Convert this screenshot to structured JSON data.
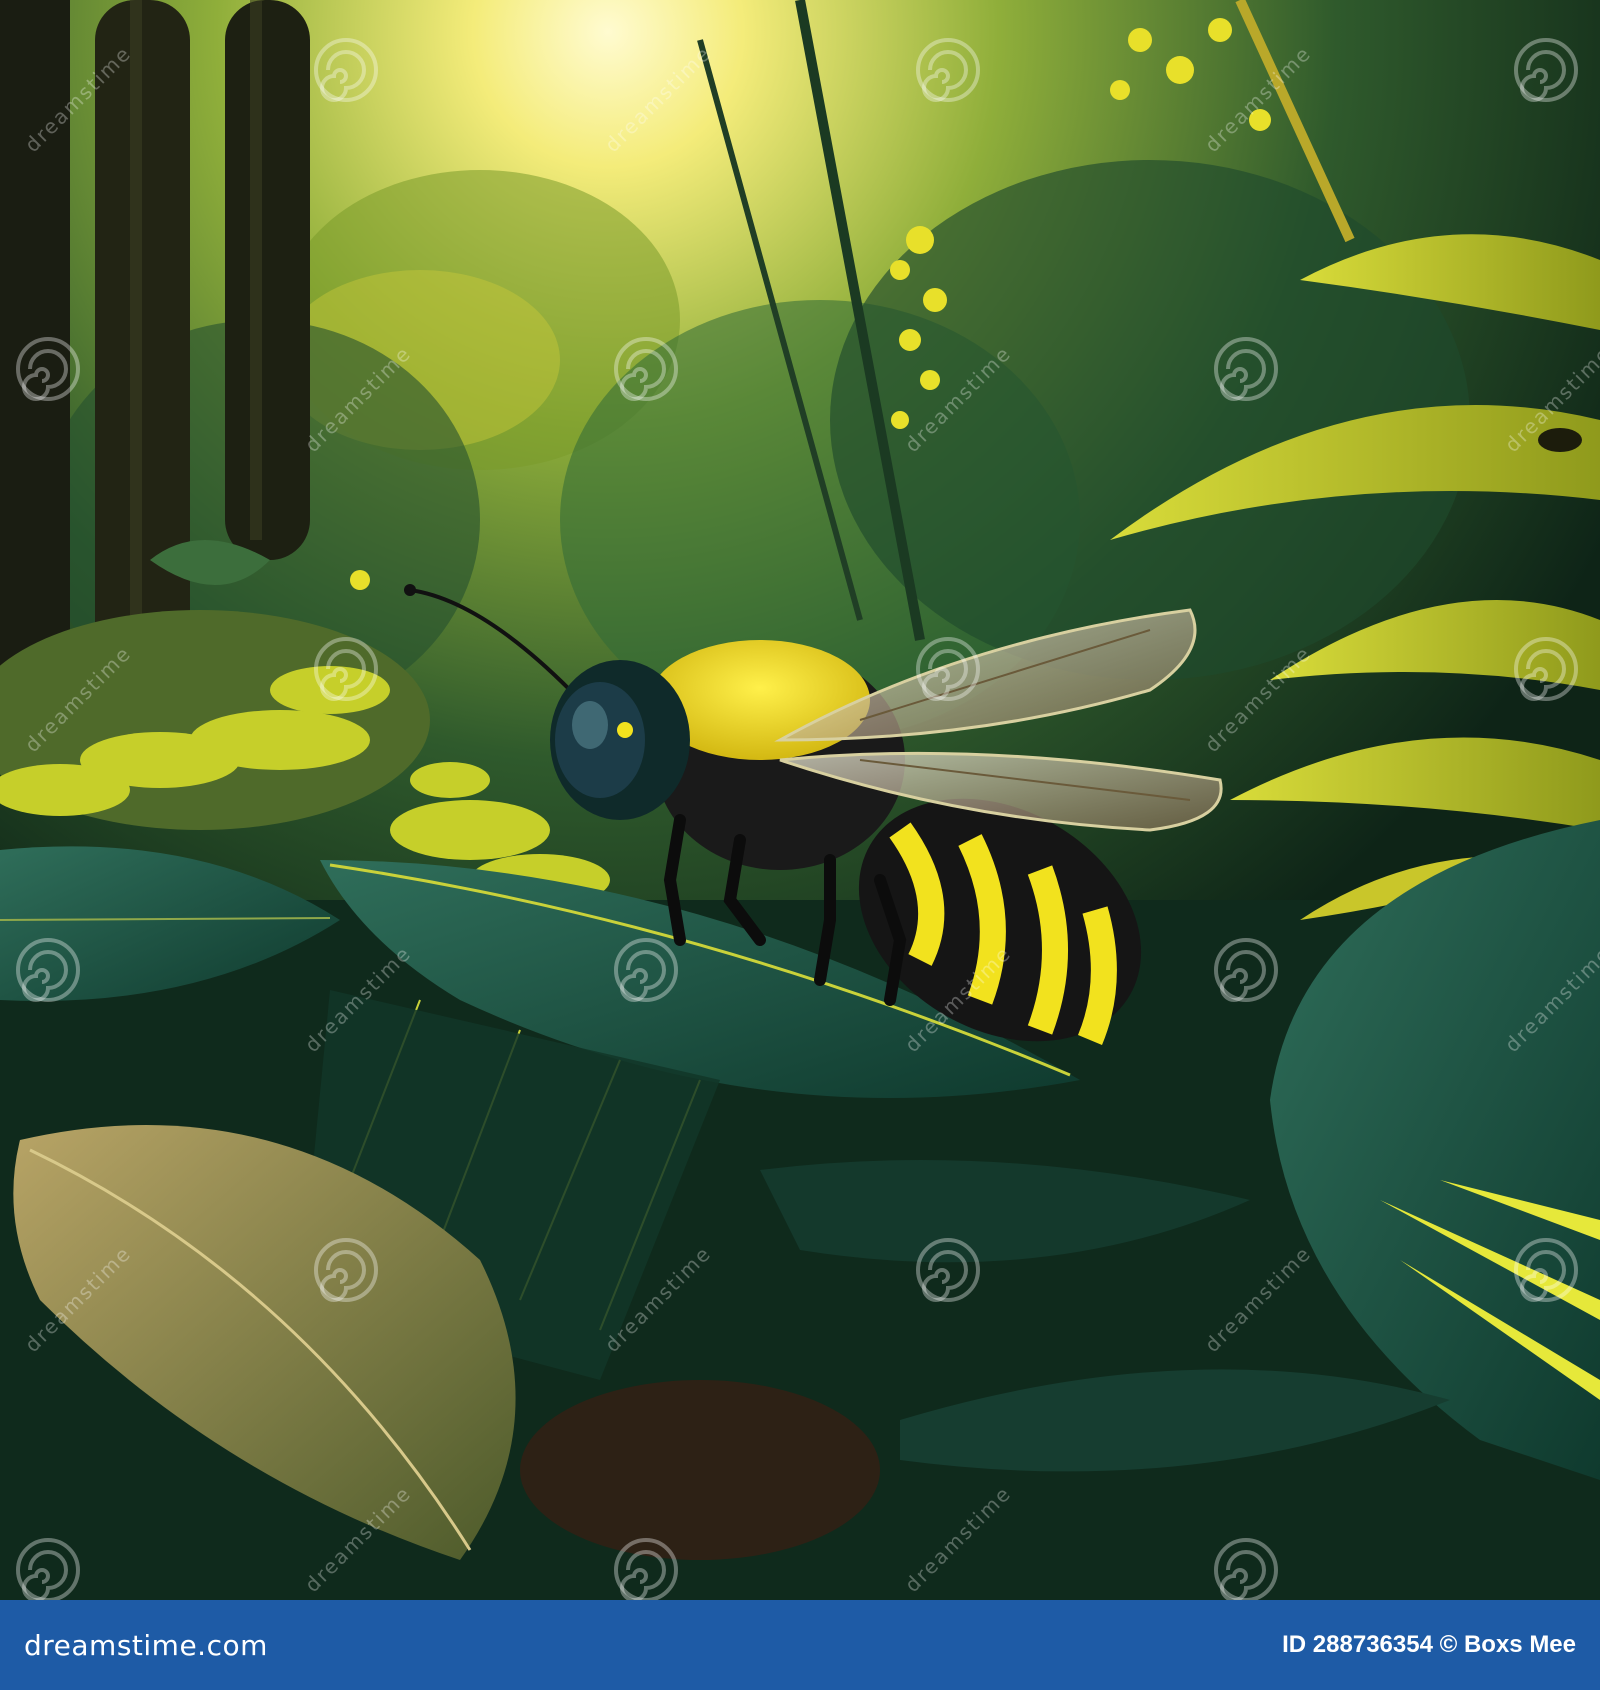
{
  "footer": {
    "brand": "dreamstime.com",
    "credit": "ID 288736354 © Boxs Mee"
  },
  "watermark": {
    "text": "dreamstime",
    "icon": "spiral-logo-icon"
  },
  "colors": {
    "footer_bar": "#1e5ba6",
    "footer_text": "#ffffff"
  }
}
